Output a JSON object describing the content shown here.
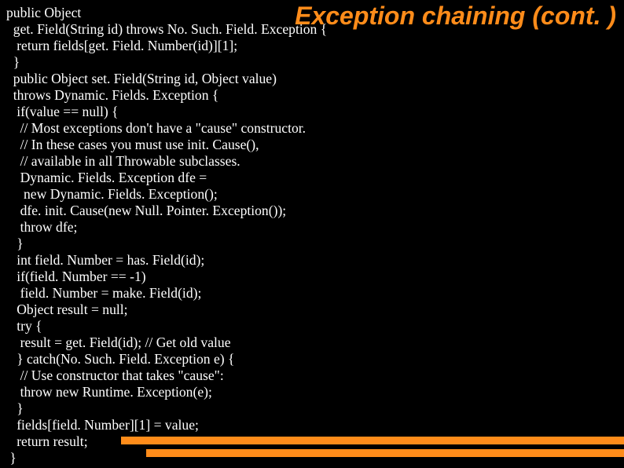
{
  "slide": {
    "heading": "Exception chaining (cont. )",
    "code_lines": [
      "public Object",
      "  get. Field(String id) throws No. Such. Field. Exception {",
      "   return fields[get. Field. Number(id)][1];",
      "  }",
      "  public Object set. Field(String id, Object value)",
      "  throws Dynamic. Fields. Exception {",
      "   if(value == null) {",
      "    // Most exceptions don't have a \"cause\" constructor.",
      "    // In these cases you must use init. Cause(),",
      "    // available in all Throwable subclasses.",
      "    Dynamic. Fields. Exception dfe =",
      "     new Dynamic. Fields. Exception();",
      "    dfe. init. Cause(new Null. Pointer. Exception());",
      "    throw dfe;",
      "   }",
      "   int field. Number = has. Field(id);",
      "   if(field. Number == -1)",
      "    field. Number = make. Field(id);",
      "   Object result = null;",
      "   try {",
      "    result = get. Field(id); // Get old value",
      "   } catch(No. Such. Field. Exception e) {",
      "    // Use constructor that takes \"cause\":",
      "    throw new Runtime. Exception(e);",
      "   }",
      "   fields[field. Number][1] = value;",
      "   return result;",
      " }"
    ]
  }
}
